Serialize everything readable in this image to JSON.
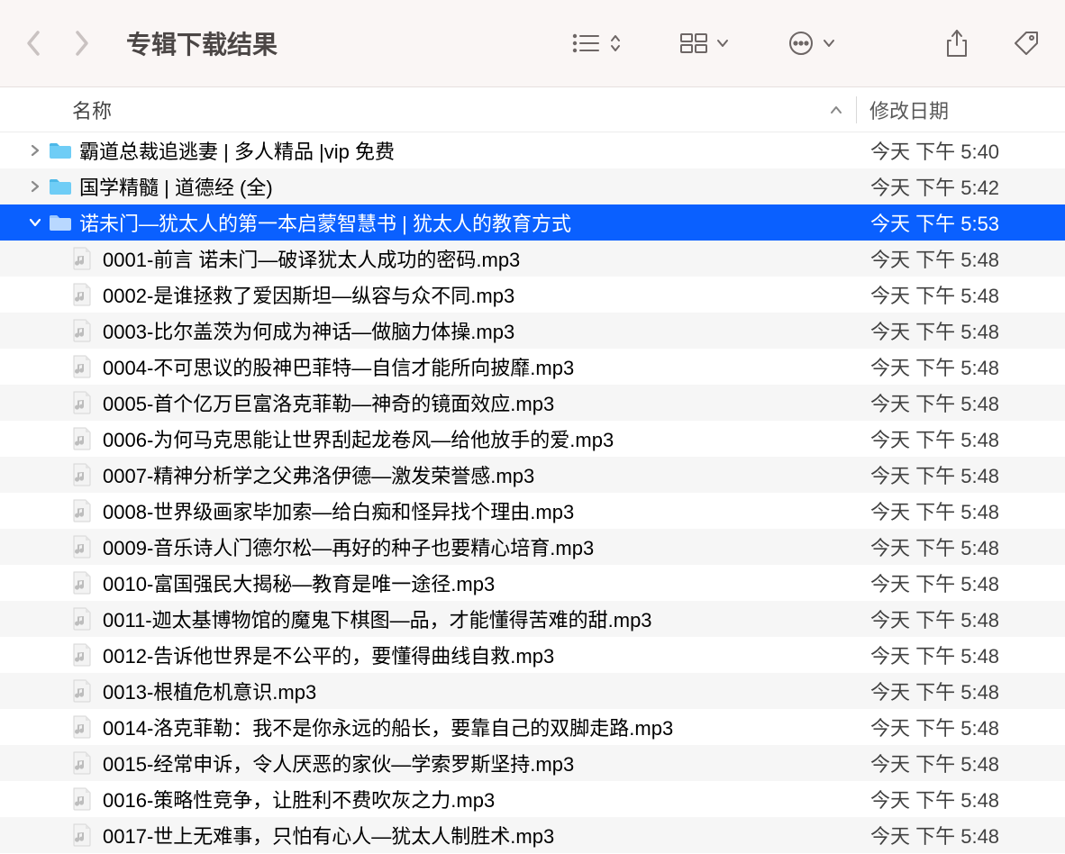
{
  "toolbar": {
    "title": "专辑下载结果"
  },
  "columns": {
    "name": "名称",
    "date": "修改日期"
  },
  "rows": [
    {
      "type": "folder",
      "disc": "right",
      "indent": 0,
      "name": "霸道总裁追逃妻 | 多人精品 |vip 免费",
      "date": "今天 下午 5:40",
      "alt": false,
      "sel": false
    },
    {
      "type": "folder",
      "disc": "right",
      "indent": 0,
      "name": "国学精髓 | 道德经 (全)",
      "date": "今天 下午 5:42",
      "alt": true,
      "sel": false
    },
    {
      "type": "folder",
      "disc": "down",
      "indent": 0,
      "name": "诺未门—犹太人的第一本启蒙智慧书 | 犹太人的教育方式",
      "date": "今天 下午 5:53",
      "alt": false,
      "sel": true
    },
    {
      "type": "file",
      "indent": 1,
      "name": "0001-前言 诺未门—破译犹太人成功的密码.mp3",
      "date": "今天 下午 5:48",
      "alt": true,
      "sel": false
    },
    {
      "type": "file",
      "indent": 1,
      "name": "0002-是谁拯救了爱因斯坦—纵容与众不同.mp3",
      "date": "今天 下午 5:48",
      "alt": false,
      "sel": false
    },
    {
      "type": "file",
      "indent": 1,
      "name": "0003-比尔盖茨为何成为神话—做脑力体操.mp3",
      "date": "今天 下午 5:48",
      "alt": true,
      "sel": false
    },
    {
      "type": "file",
      "indent": 1,
      "name": "0004-不可思议的股神巴菲特—自信才能所向披靡.mp3",
      "date": "今天 下午 5:48",
      "alt": false,
      "sel": false
    },
    {
      "type": "file",
      "indent": 1,
      "name": "0005-首个亿万巨富洛克菲勒—神奇的镜面效应.mp3",
      "date": "今天 下午 5:48",
      "alt": true,
      "sel": false
    },
    {
      "type": "file",
      "indent": 1,
      "name": "0006-为何马克思能让世界刮起龙卷风—给他放手的爱.mp3",
      "date": "今天 下午 5:48",
      "alt": false,
      "sel": false
    },
    {
      "type": "file",
      "indent": 1,
      "name": "0007-精神分析学之父弗洛伊德—激发荣誉感.mp3",
      "date": "今天 下午 5:48",
      "alt": true,
      "sel": false
    },
    {
      "type": "file",
      "indent": 1,
      "name": "0008-世界级画家毕加索—给白痴和怪异找个理由.mp3",
      "date": "今天 下午 5:48",
      "alt": false,
      "sel": false
    },
    {
      "type": "file",
      "indent": 1,
      "name": "0009-音乐诗人门德尔松—再好的种子也要精心培育.mp3",
      "date": "今天 下午 5:48",
      "alt": true,
      "sel": false
    },
    {
      "type": "file",
      "indent": 1,
      "name": "0010-富国强民大揭秘—教育是唯一途径.mp3",
      "date": "今天 下午 5:48",
      "alt": false,
      "sel": false
    },
    {
      "type": "file",
      "indent": 1,
      "name": "0011-迦太基博物馆的魔鬼下棋图—品，才能懂得苦难的甜.mp3",
      "date": "今天 下午 5:48",
      "alt": true,
      "sel": false
    },
    {
      "type": "file",
      "indent": 1,
      "name": "0012-告诉他世界是不公平的，要懂得曲线自救.mp3",
      "date": "今天 下午 5:48",
      "alt": false,
      "sel": false
    },
    {
      "type": "file",
      "indent": 1,
      "name": "0013-根植危机意识.mp3",
      "date": "今天 下午 5:48",
      "alt": true,
      "sel": false
    },
    {
      "type": "file",
      "indent": 1,
      "name": "0014-洛克菲勒：我不是你永远的船长，要靠自己的双脚走路.mp3",
      "date": "今天 下午 5:48",
      "alt": false,
      "sel": false
    },
    {
      "type": "file",
      "indent": 1,
      "name": "0015-经常申诉，令人厌恶的家伙—学索罗斯坚持.mp3",
      "date": "今天 下午 5:48",
      "alt": true,
      "sel": false
    },
    {
      "type": "file",
      "indent": 1,
      "name": "0016-策略性竞争，让胜利不费吹灰之力.mp3",
      "date": "今天 下午 5:48",
      "alt": false,
      "sel": false
    },
    {
      "type": "file",
      "indent": 1,
      "name": "0017-世上无难事，只怕有心人—犹太人制胜术.mp3",
      "date": "今天 下午 5:48",
      "alt": true,
      "sel": false
    }
  ]
}
